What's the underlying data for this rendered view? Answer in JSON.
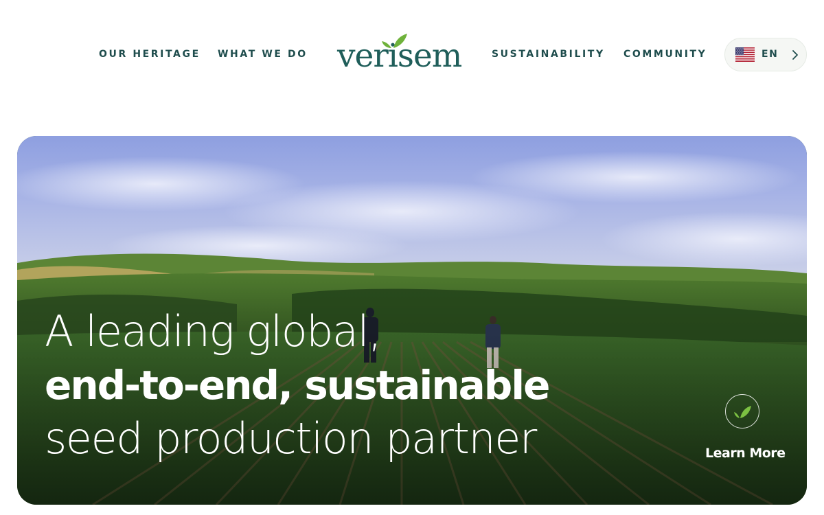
{
  "nav": {
    "left": [
      {
        "label": "OUR HERITAGE"
      },
      {
        "label": "WHAT WE DO"
      }
    ],
    "right": [
      {
        "label": "SUSTAINABILITY"
      },
      {
        "label": "COMMUNITY"
      }
    ]
  },
  "logo": {
    "text": "verisem",
    "colors": {
      "text": "#1f5e5a",
      "leaf": "#6fb23b"
    }
  },
  "language": {
    "code": "EN",
    "flag_icon": "us-flag-icon",
    "chevron_icon": "chevron-right-icon"
  },
  "hero": {
    "headline": {
      "line1": "A leading global,",
      "line2": "end-to-end, sustainable",
      "line3": "seed production partner"
    },
    "cta": {
      "label": "Learn More",
      "icon": "leaf-icon"
    }
  },
  "colors": {
    "nav_text": "#1f4d4d",
    "accent_leaf": "#7cc142",
    "hero_text": "#ffffff"
  }
}
